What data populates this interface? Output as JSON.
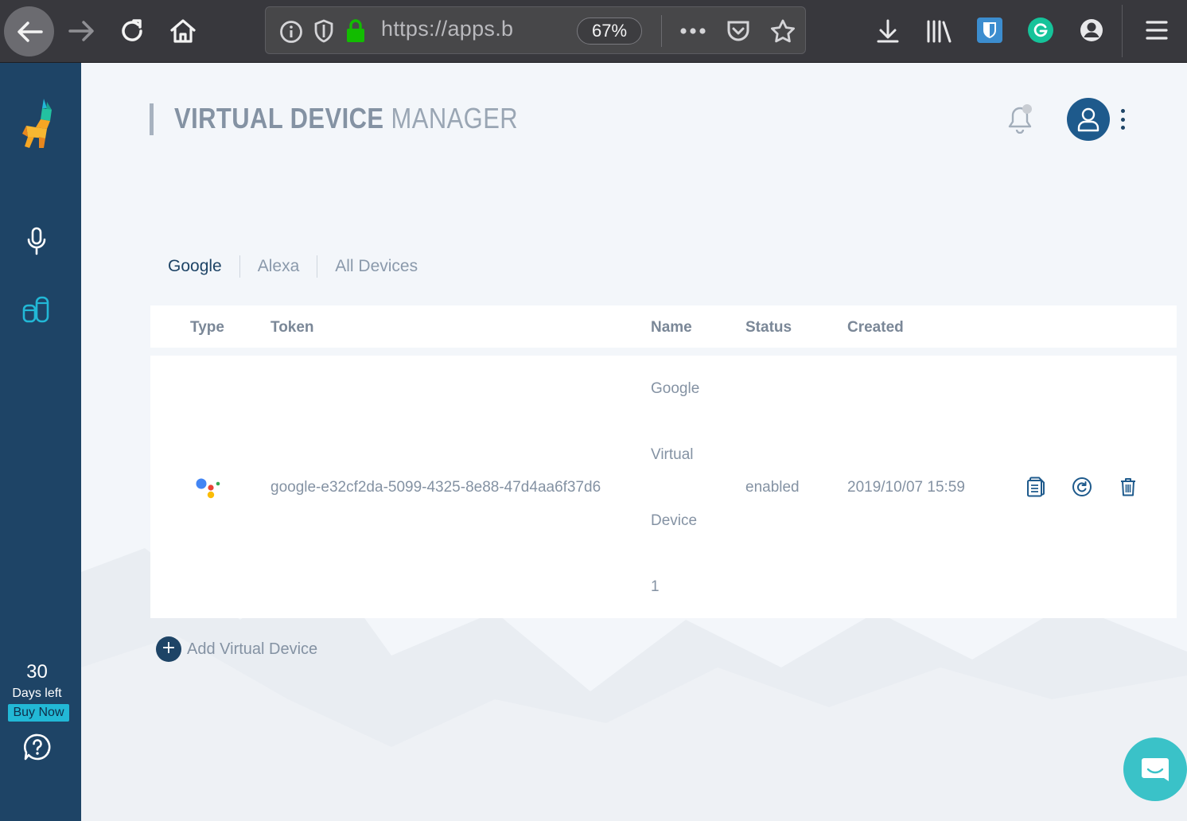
{
  "browser": {
    "url": "https://apps.b",
    "zoom": "67%",
    "icons": [
      "back-arrow-icon",
      "forward-arrow-icon",
      "reload-icon",
      "home-icon",
      "info-icon",
      "shield-icon",
      "lock-icon",
      "more-icon",
      "pocket-icon",
      "bookmark-star-icon",
      "download-icon",
      "library-icon",
      "bitwarden-icon",
      "grammarly-icon",
      "account-icon",
      "hamburger-menu-icon"
    ]
  },
  "sidebar": {
    "logo": "llama-logo-icon",
    "items": [
      {
        "icon": "microphone-icon"
      },
      {
        "icon": "virtual-devices-icon"
      }
    ],
    "trial": {
      "days": "30",
      "label": "Days left",
      "buy": "Buy Now"
    },
    "help_icon": "help-question-icon"
  },
  "header": {
    "title_bold": "VIRTUAL DEVICE",
    "title_light": " MANAGER"
  },
  "tabs": [
    "Google",
    "Alexa",
    "All Devices"
  ],
  "active_tab": "Google",
  "table": {
    "columns": [
      "Type",
      "Token",
      "Name",
      "Status",
      "Created"
    ],
    "rows": [
      {
        "type_icon": "google-assistant-icon",
        "token": "google-e32cf2da-5099-4325-8e88-47d4aa6f37d6",
        "name_lines": [
          "Google",
          "Virtual",
          "Device",
          "1"
        ],
        "status": "enabled",
        "created": "2019/10/07 15:59",
        "actions": [
          "copy-token-icon",
          "refresh-token-icon",
          "delete-icon"
        ]
      }
    ]
  },
  "add_device": {
    "label": "Add Virtual Device",
    "icon": "plus-icon"
  },
  "colors": {
    "sidebar": "#1e4466",
    "accent": "#22b8d6",
    "chat": "#3ac2c8",
    "google_blue": "#4285f4",
    "google_red": "#ea4335",
    "google_yellow": "#fbbc05",
    "google_green": "#34a853"
  }
}
